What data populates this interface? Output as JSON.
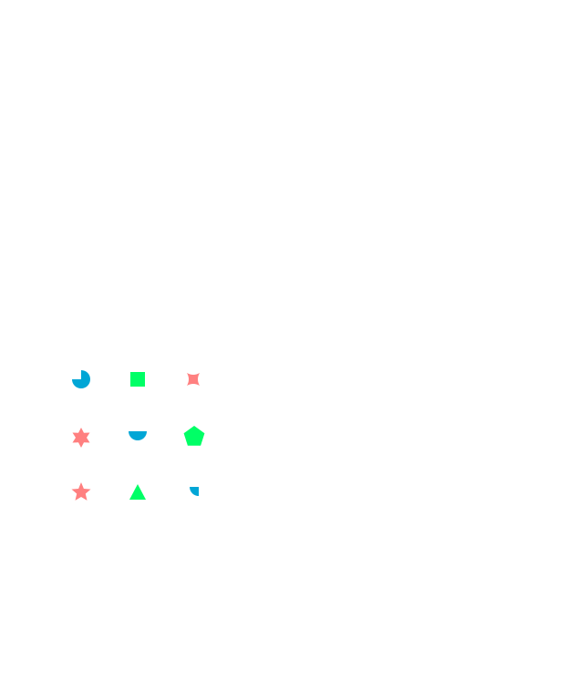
{
  "colors": {
    "blue": "#00a6d6",
    "green": "#00ff66",
    "pink": "#ff8080",
    "background": "#ffffff"
  },
  "grid": [
    [
      {
        "shape": "three-quarter-circle",
        "color": "blue"
      },
      {
        "shape": "square",
        "color": "green"
      },
      {
        "shape": "four-point-concave-star",
        "color": "pink"
      }
    ],
    [
      {
        "shape": "six-point-star",
        "color": "pink"
      },
      {
        "shape": "half-circle",
        "color": "blue"
      },
      {
        "shape": "pentagon",
        "color": "green"
      }
    ],
    [
      {
        "shape": "five-point-star",
        "color": "pink"
      },
      {
        "shape": "triangle",
        "color": "green"
      },
      {
        "shape": "quarter-circle",
        "color": "blue"
      }
    ]
  ]
}
